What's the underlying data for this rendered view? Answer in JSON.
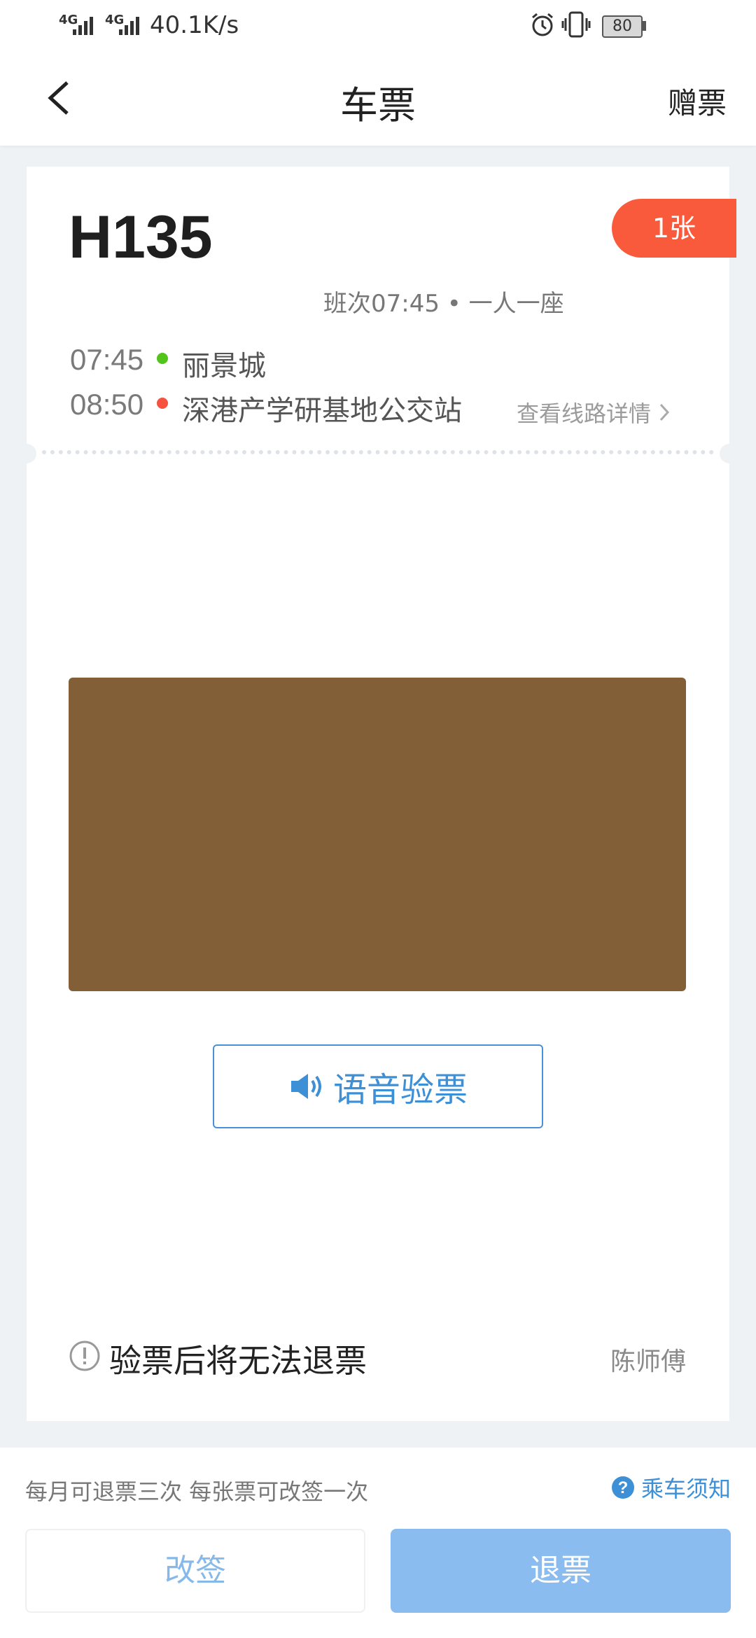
{
  "status_bar": {
    "signal1_label": "4G",
    "signal2_label": "4G",
    "net_speed": "40.1K/s",
    "battery": "80"
  },
  "header": {
    "title": "车票",
    "gift_label": "赠票"
  },
  "ticket": {
    "bus_number": "H135",
    "count_badge": "1张",
    "schedule": "班次07:45 • 一人一座",
    "stops": [
      {
        "time": "07:45",
        "name": "丽景城",
        "dot_color": "#52c41a"
      },
      {
        "time": "08:50",
        "name": "深港产学研基地公交站",
        "dot_color": "#f5533d"
      }
    ],
    "route_link": "查看线路详情",
    "voice_button": "语音验票",
    "warning": "验票后将无法退票",
    "driver": "陈师傅"
  },
  "footer": {
    "notice": "每月可退票三次 每张票可改签一次",
    "rules_link": "乘车须知",
    "change_button": "改签",
    "refund_button": "退票"
  },
  "colors": {
    "accent": "#3d8fd6",
    "badge": "#fa5a3c",
    "qr_placeholder": "#835f38",
    "refund_button": "#8bbcef"
  }
}
